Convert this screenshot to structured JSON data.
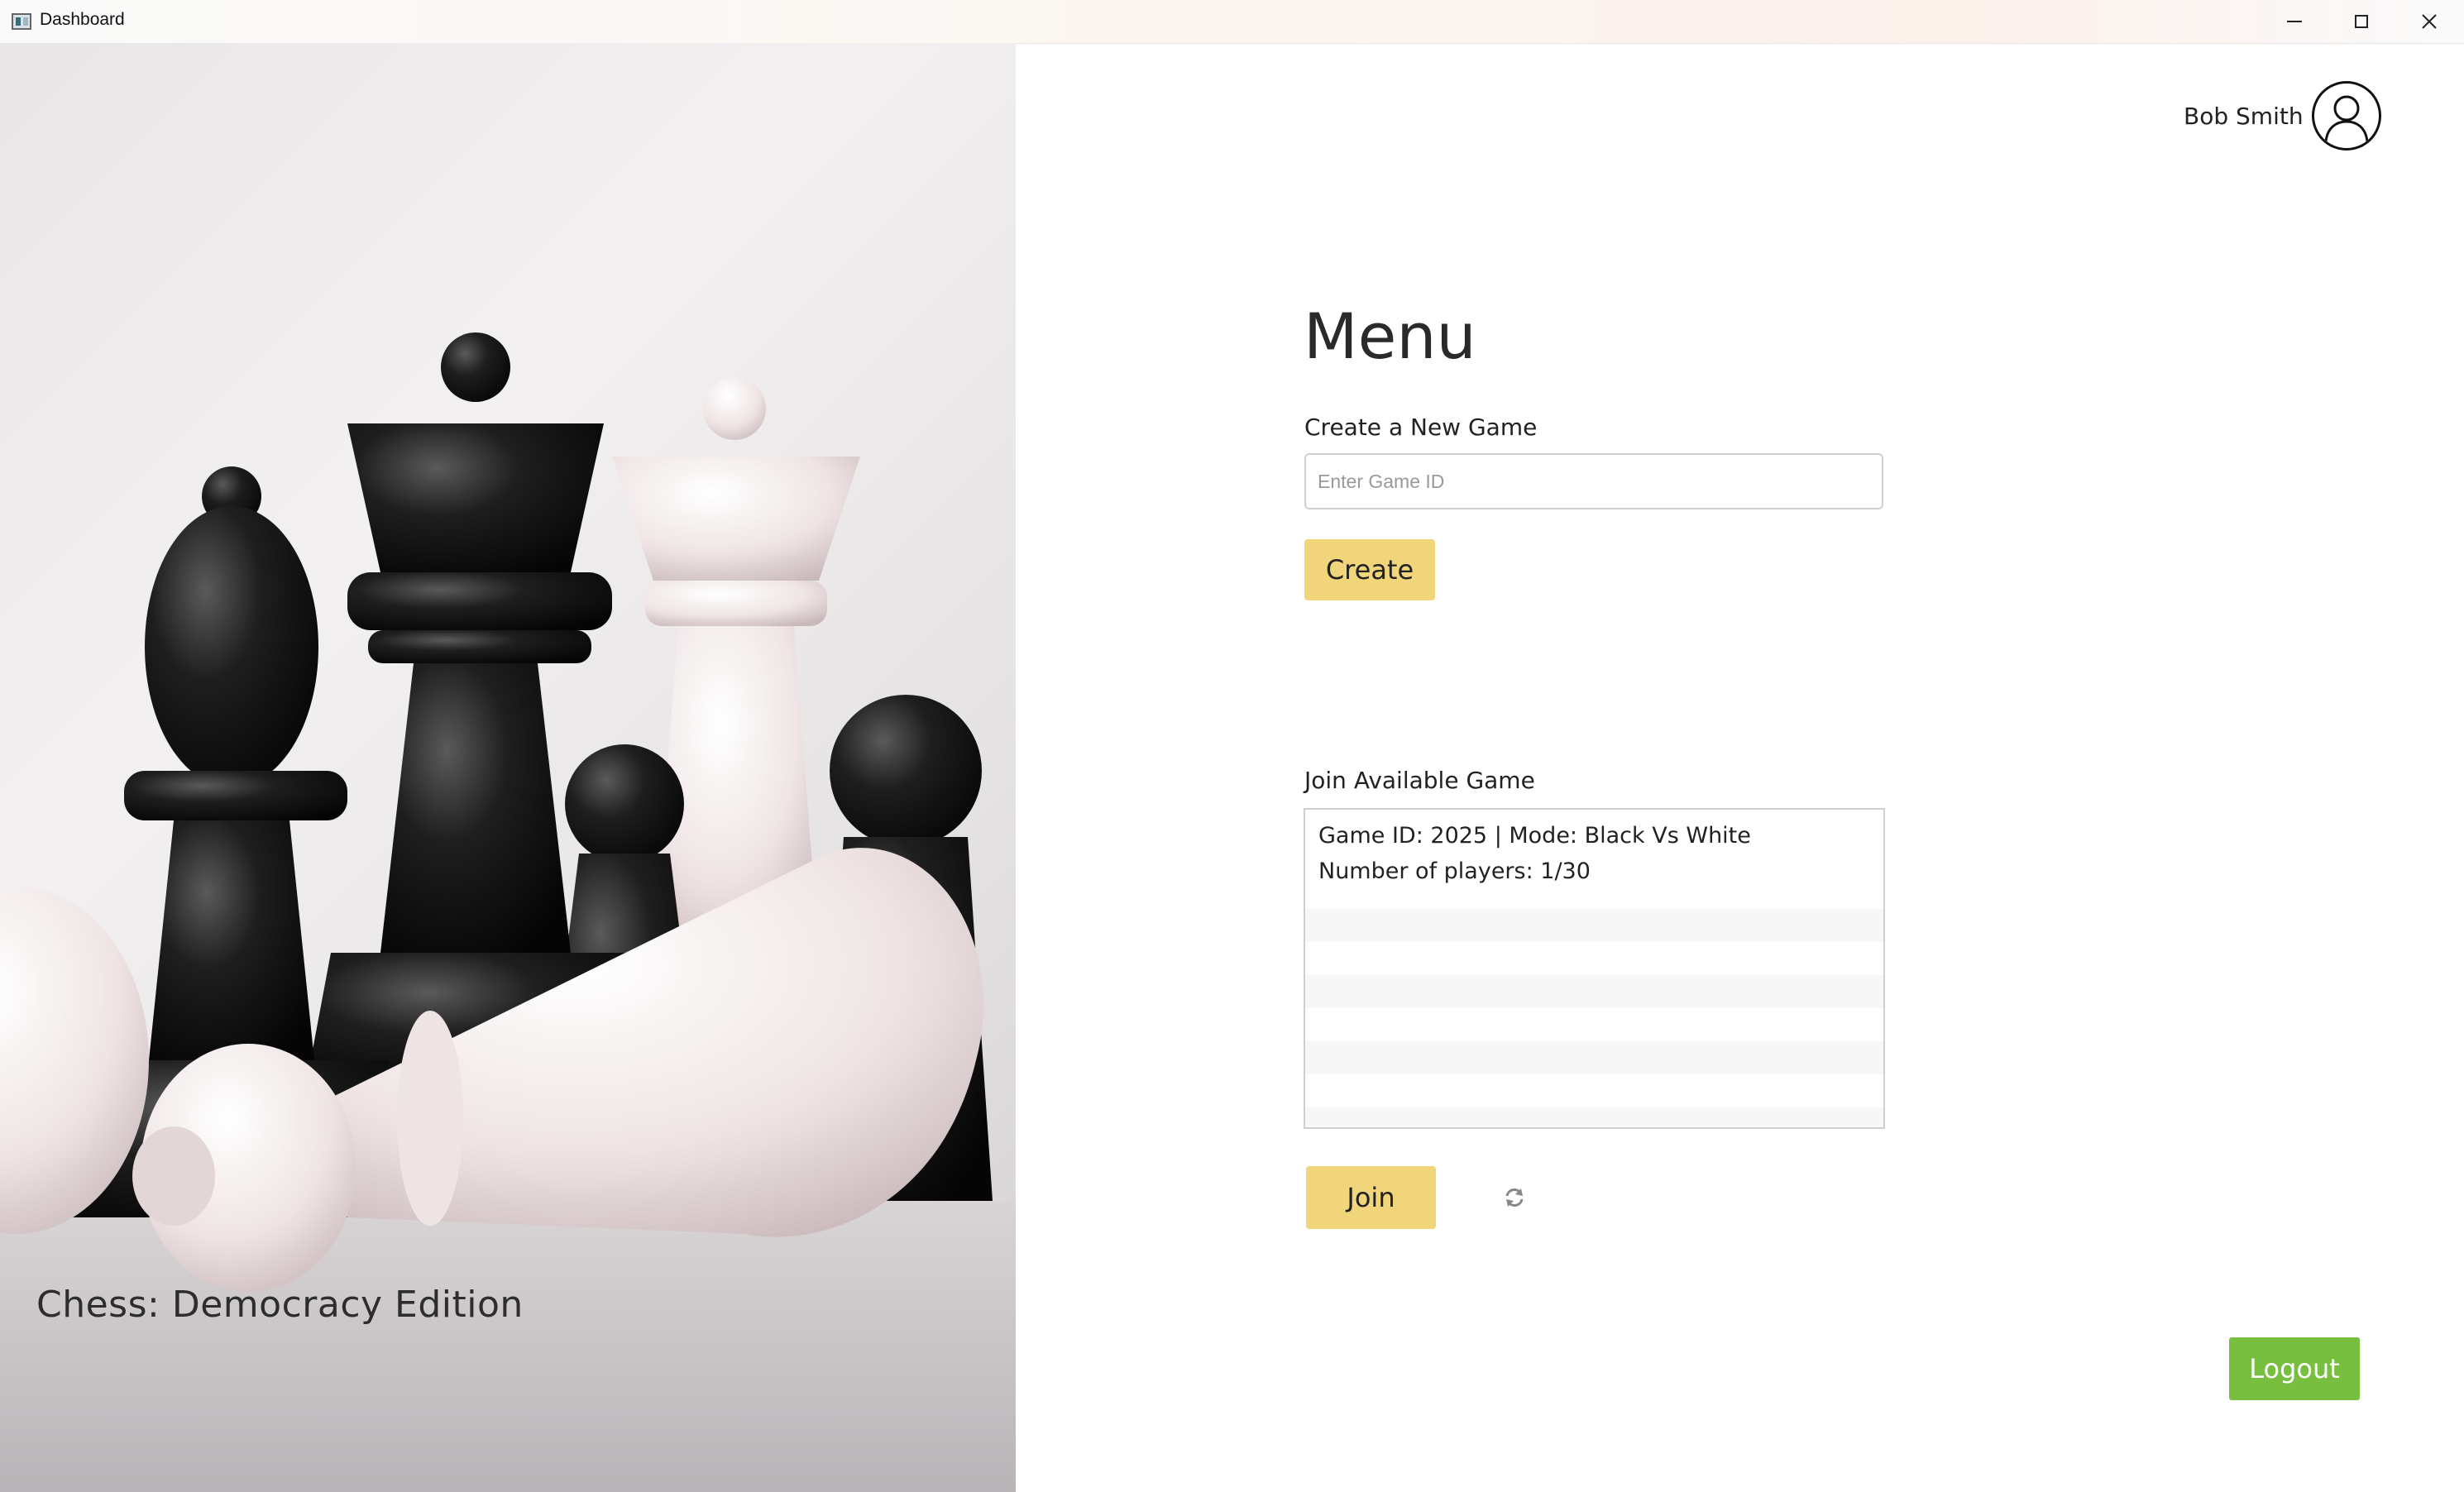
{
  "window": {
    "title": "Dashboard",
    "minimize_icon": "minimize-icon",
    "maximize_icon": "maximize-icon",
    "close_icon": "close-icon"
  },
  "hero": {
    "caption": "Chess: Democracy Edition",
    "image": "chess-pieces-photo"
  },
  "user": {
    "name": "Bob Smith",
    "avatar_icon": "user-avatar-icon"
  },
  "menu": {
    "title": "Menu",
    "create_section": {
      "label": "Create a New Game",
      "input_placeholder": "Enter Game ID",
      "input_value": "",
      "button_label": "Create"
    },
    "join_section": {
      "label": "Join Available Game",
      "games": [
        {
          "line1": "Game ID: 2025 | Mode: Black Vs White",
          "line2": "Number of players: 1/30"
        }
      ],
      "button_label": "Join",
      "refresh_icon": "refresh-icon"
    },
    "logout_label": "Logout"
  },
  "colors": {
    "accent_yellow": "#f1d57a",
    "logout_green": "#78bf40"
  }
}
